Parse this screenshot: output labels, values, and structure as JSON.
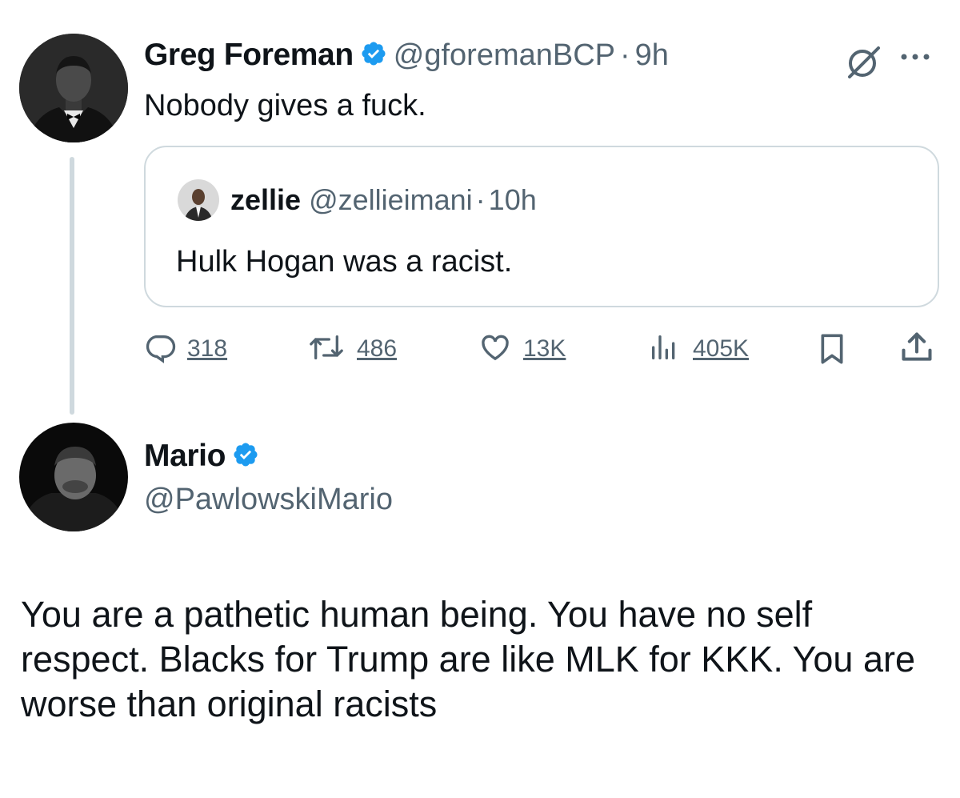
{
  "tweet1": {
    "author_name": "Greg Foreman",
    "handle": "@gforemanBCP",
    "separator": "·",
    "time": "9h",
    "text": "Nobody gives a fuck.",
    "verified": true,
    "icons": {
      "grok": "grok-icon",
      "more": "more-icon"
    }
  },
  "quoted": {
    "author_name": "zellie",
    "handle": "@zellieimani",
    "separator": "·",
    "time": "10h",
    "text": "Hulk Hogan was a racist."
  },
  "actions": {
    "replies": "318",
    "retweets": "486",
    "likes": "13K",
    "views": "405K",
    "icons": [
      "reply-icon",
      "retweet-icon",
      "like-icon",
      "views-icon",
      "bookmark-icon",
      "share-icon"
    ]
  },
  "reply": {
    "author_name": "Mario",
    "handle": "@PawlowskiMario",
    "verified": true,
    "text": "You are a pathetic human being. You have no self respect. Blacks for Trump are like MLK for KKK. You are worse than original racists"
  },
  "colors": {
    "text_primary": "#0f1419",
    "text_secondary": "#536471",
    "verified_blue": "#1d9bf0",
    "border": "#cfd9de"
  }
}
